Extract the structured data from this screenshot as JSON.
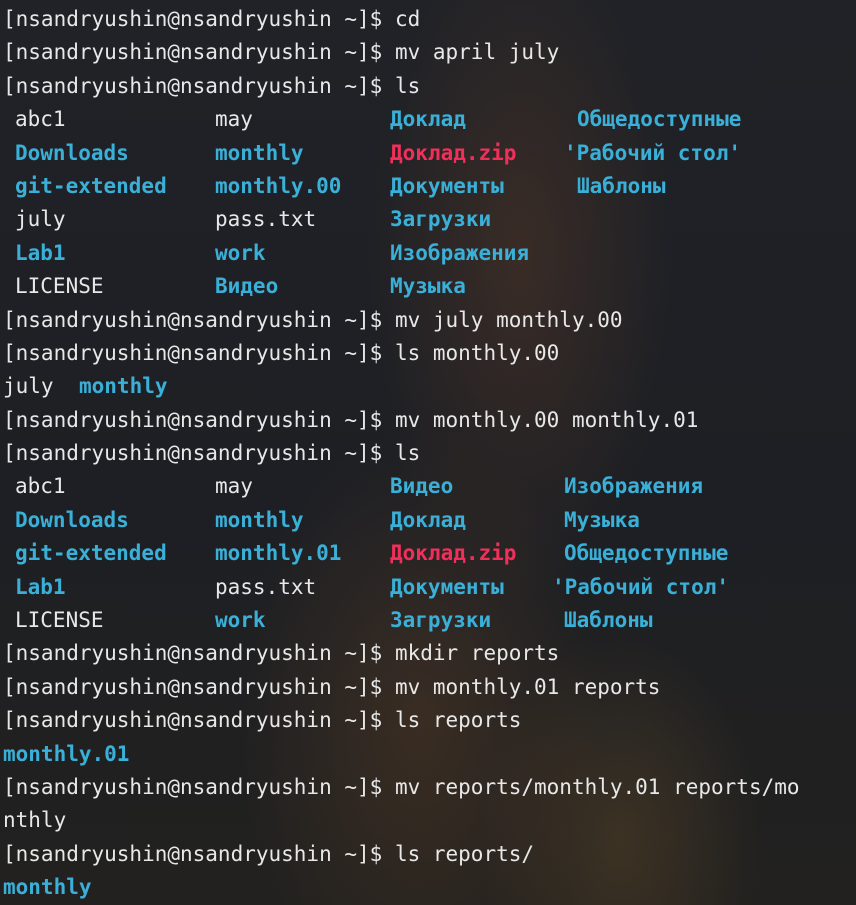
{
  "prompt": "[nsandryushin@nsandryushin ~]$ ",
  "colors": {
    "background": "#1b1d22",
    "text": "#e8e8e8",
    "directory": "#3ab0d8",
    "archive": "#f0305a"
  },
  "commands": {
    "c1": "cd",
    "c2": "mv april july",
    "c3": "ls",
    "c4": "mv july monthly.00",
    "c5": "ls monthly.00",
    "c6": "mv monthly.00 monthly.01",
    "c7": "ls",
    "c8": "mkdir reports",
    "c9": "mv monthly.01 reports",
    "c10": "ls reports",
    "c11": "mv reports/monthly.01 reports/mo",
    "c11_wrap": "nthly",
    "c12": "ls reports/"
  },
  "ls1": [
    [
      "abc1",
      "may",
      "Доклад",
      "Общедоступные"
    ],
    [
      "Downloads",
      "monthly",
      "Доклад.zip",
      "'Рабочий стол'"
    ],
    [
      "git-extended",
      "monthly.00",
      "Документы",
      "Шаблоны"
    ],
    [
      "july",
      "pass.txt",
      "Загрузки",
      ""
    ],
    [
      "Lab1",
      "work",
      "Изображения",
      ""
    ],
    [
      "LICENSE",
      "Видео",
      "Музыка",
      ""
    ]
  ],
  "ls_monthly00": [
    "july",
    "monthly"
  ],
  "ls2": [
    [
      "abc1",
      "may",
      "Видео",
      "Изображения"
    ],
    [
      "Downloads",
      "monthly",
      "Доклад",
      "Музыка"
    ],
    [
      "git-extended",
      "monthly.01",
      "Доклад.zip",
      "Общедоступные"
    ],
    [
      "Lab1",
      "pass.txt",
      "Документы",
      "'Рабочий стол'"
    ],
    [
      "LICENSE",
      "work",
      "Загрузки",
      "Шаблоны"
    ]
  ],
  "ls_reports": "monthly.01",
  "ls_reports_final": "monthly"
}
